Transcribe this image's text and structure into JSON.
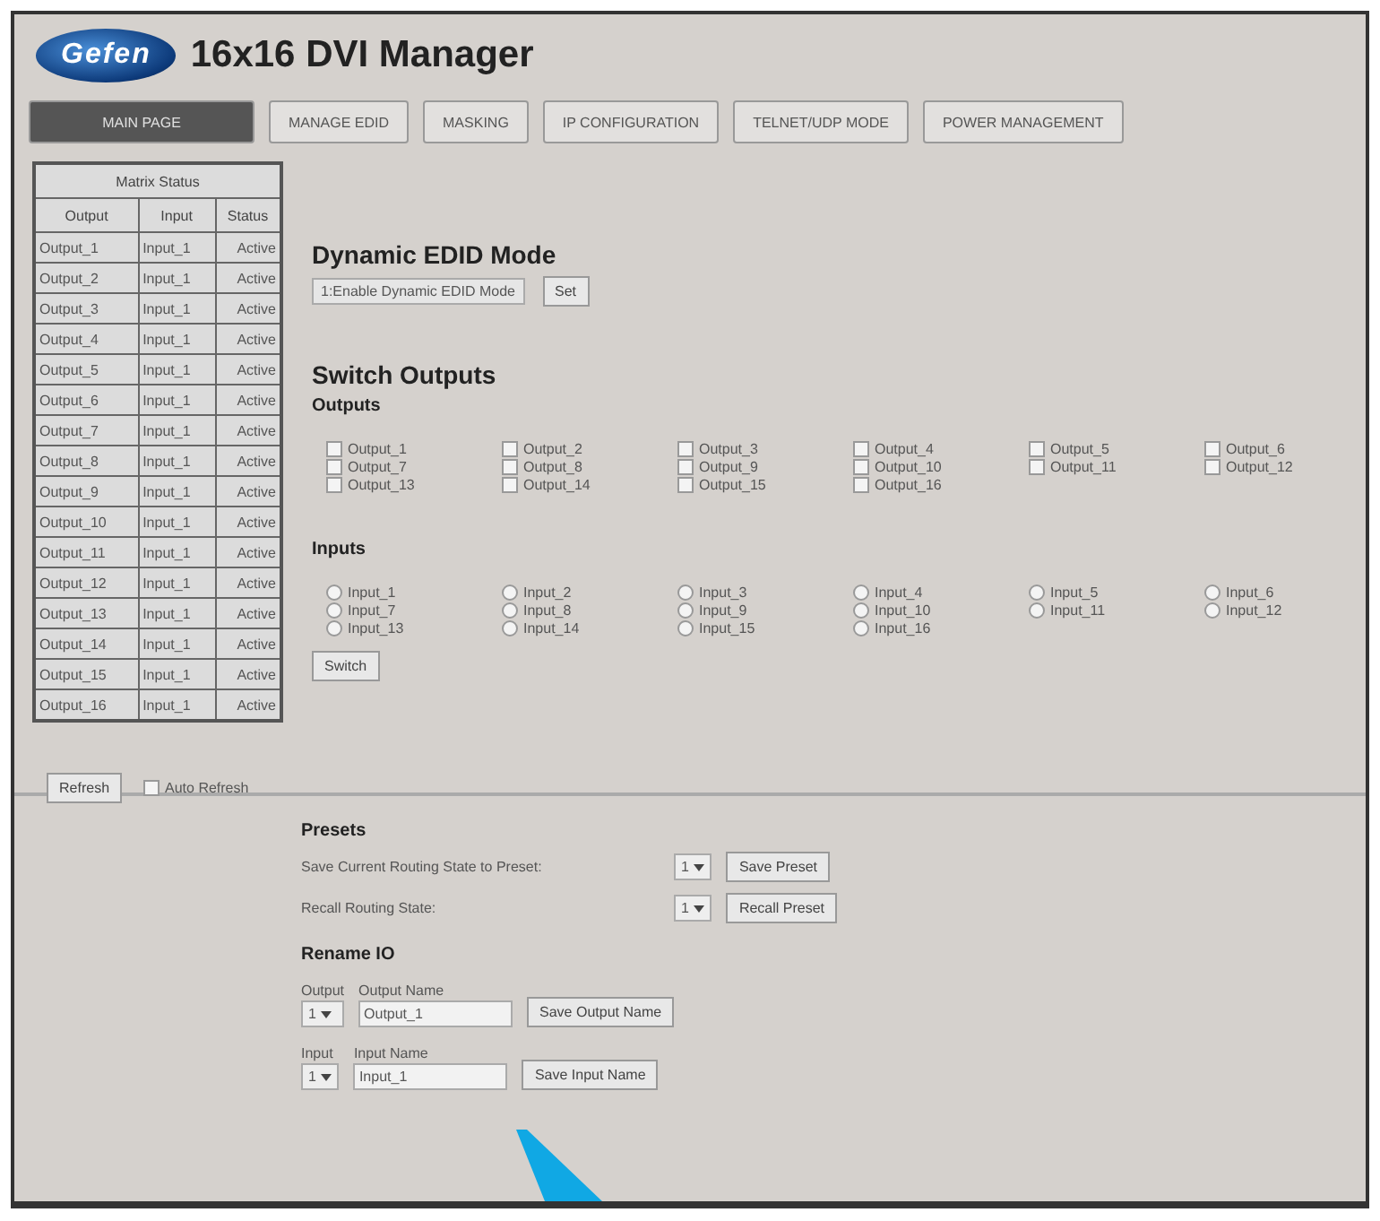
{
  "header": {
    "logo": "Gefen",
    "title": "16x16 DVI Manager"
  },
  "tabs": [
    {
      "label": "MAIN PAGE",
      "selected": true
    },
    {
      "label": "MANAGE EDID",
      "selected": false
    },
    {
      "label": "MASKING",
      "selected": false
    },
    {
      "label": "IP CONFIGURATION",
      "selected": false
    },
    {
      "label": "TELNET/UDP MODE",
      "selected": false
    },
    {
      "label": "POWER MANAGEMENT",
      "selected": false
    }
  ],
  "matrix": {
    "title": "Matrix Status",
    "columns": [
      "Output",
      "Input",
      "Status"
    ],
    "rows": [
      [
        "Output_1",
        "Input_1",
        "Active"
      ],
      [
        "Output_2",
        "Input_1",
        "Active"
      ],
      [
        "Output_3",
        "Input_1",
        "Active"
      ],
      [
        "Output_4",
        "Input_1",
        "Active"
      ],
      [
        "Output_5",
        "Input_1",
        "Active"
      ],
      [
        "Output_6",
        "Input_1",
        "Active"
      ],
      [
        "Output_7",
        "Input_1",
        "Active"
      ],
      [
        "Output_8",
        "Input_1",
        "Active"
      ],
      [
        "Output_9",
        "Input_1",
        "Active"
      ],
      [
        "Output_10",
        "Input_1",
        "Active"
      ],
      [
        "Output_11",
        "Input_1",
        "Active"
      ],
      [
        "Output_12",
        "Input_1",
        "Active"
      ],
      [
        "Output_13",
        "Input_1",
        "Active"
      ],
      [
        "Output_14",
        "Input_1",
        "Active"
      ],
      [
        "Output_15",
        "Input_1",
        "Active"
      ],
      [
        "Output_16",
        "Input_1",
        "Active"
      ]
    ],
    "refresh_button": "Refresh",
    "auto_refresh": {
      "label": "Auto Refresh",
      "checked": false
    }
  },
  "edid": {
    "heading": "Dynamic EDID Mode",
    "select": "1:Enable Dynamic EDID Mode",
    "button": "Set"
  },
  "switch": {
    "heading": "Switch Outputs",
    "outputs_label": "Outputs",
    "outputs": [
      {
        "label": "Output_1",
        "checked": false
      },
      {
        "label": "Output_2",
        "checked": false
      },
      {
        "label": "Output_3",
        "checked": false
      },
      {
        "label": "Output_4",
        "checked": false
      },
      {
        "label": "Output_5",
        "checked": false
      },
      {
        "label": "Output_6",
        "checked": false
      },
      {
        "label": "Output_7",
        "checked": false
      },
      {
        "label": "Output_8",
        "checked": false
      },
      {
        "label": "Output_9",
        "checked": false
      },
      {
        "label": "Output_10",
        "checked": false
      },
      {
        "label": "Output_11",
        "checked": false
      },
      {
        "label": "Output_12",
        "checked": false
      },
      {
        "label": "Output_13",
        "checked": false
      },
      {
        "label": "Output_14",
        "checked": false
      },
      {
        "label": "Output_15",
        "checked": false
      },
      {
        "label": "Output_16",
        "checked": false
      }
    ],
    "inputs_label": "Inputs",
    "inputs": [
      {
        "label": "Input_1",
        "selected": false
      },
      {
        "label": "Input_2",
        "selected": false
      },
      {
        "label": "Input_3",
        "selected": false
      },
      {
        "label": "Input_4",
        "selected": false
      },
      {
        "label": "Input_5",
        "selected": false
      },
      {
        "label": "Input_6",
        "selected": false
      },
      {
        "label": "Input_7",
        "selected": false
      },
      {
        "label": "Input_8",
        "selected": false
      },
      {
        "label": "Input_9",
        "selected": false
      },
      {
        "label": "Input_10",
        "selected": false
      },
      {
        "label": "Input_11",
        "selected": false
      },
      {
        "label": "Input_12",
        "selected": false
      },
      {
        "label": "Input_13",
        "selected": false
      },
      {
        "label": "Input_14",
        "selected": false
      },
      {
        "label": "Input_15",
        "selected": false
      },
      {
        "label": "Input_16",
        "selected": false
      }
    ],
    "button": "Switch"
  },
  "presets": {
    "heading": "Presets",
    "rows": [
      {
        "label": "Save Current Routing State to Preset:",
        "value": "1",
        "button": "Save Preset"
      },
      {
        "label": "Recall Routing State:",
        "value": "1",
        "button": "Recall Preset"
      }
    ]
  },
  "rename": {
    "heading": "Rename IO",
    "rows": [
      {
        "select_label": "Output",
        "select_value": "1",
        "name_label": "Output Name",
        "name_value": "Output_1",
        "button": "Save Output Name"
      },
      {
        "select_label": "Input",
        "select_value": "1",
        "name_label": "Input Name",
        "name_value": "Input_1",
        "button": "Save Input Name"
      }
    ]
  }
}
